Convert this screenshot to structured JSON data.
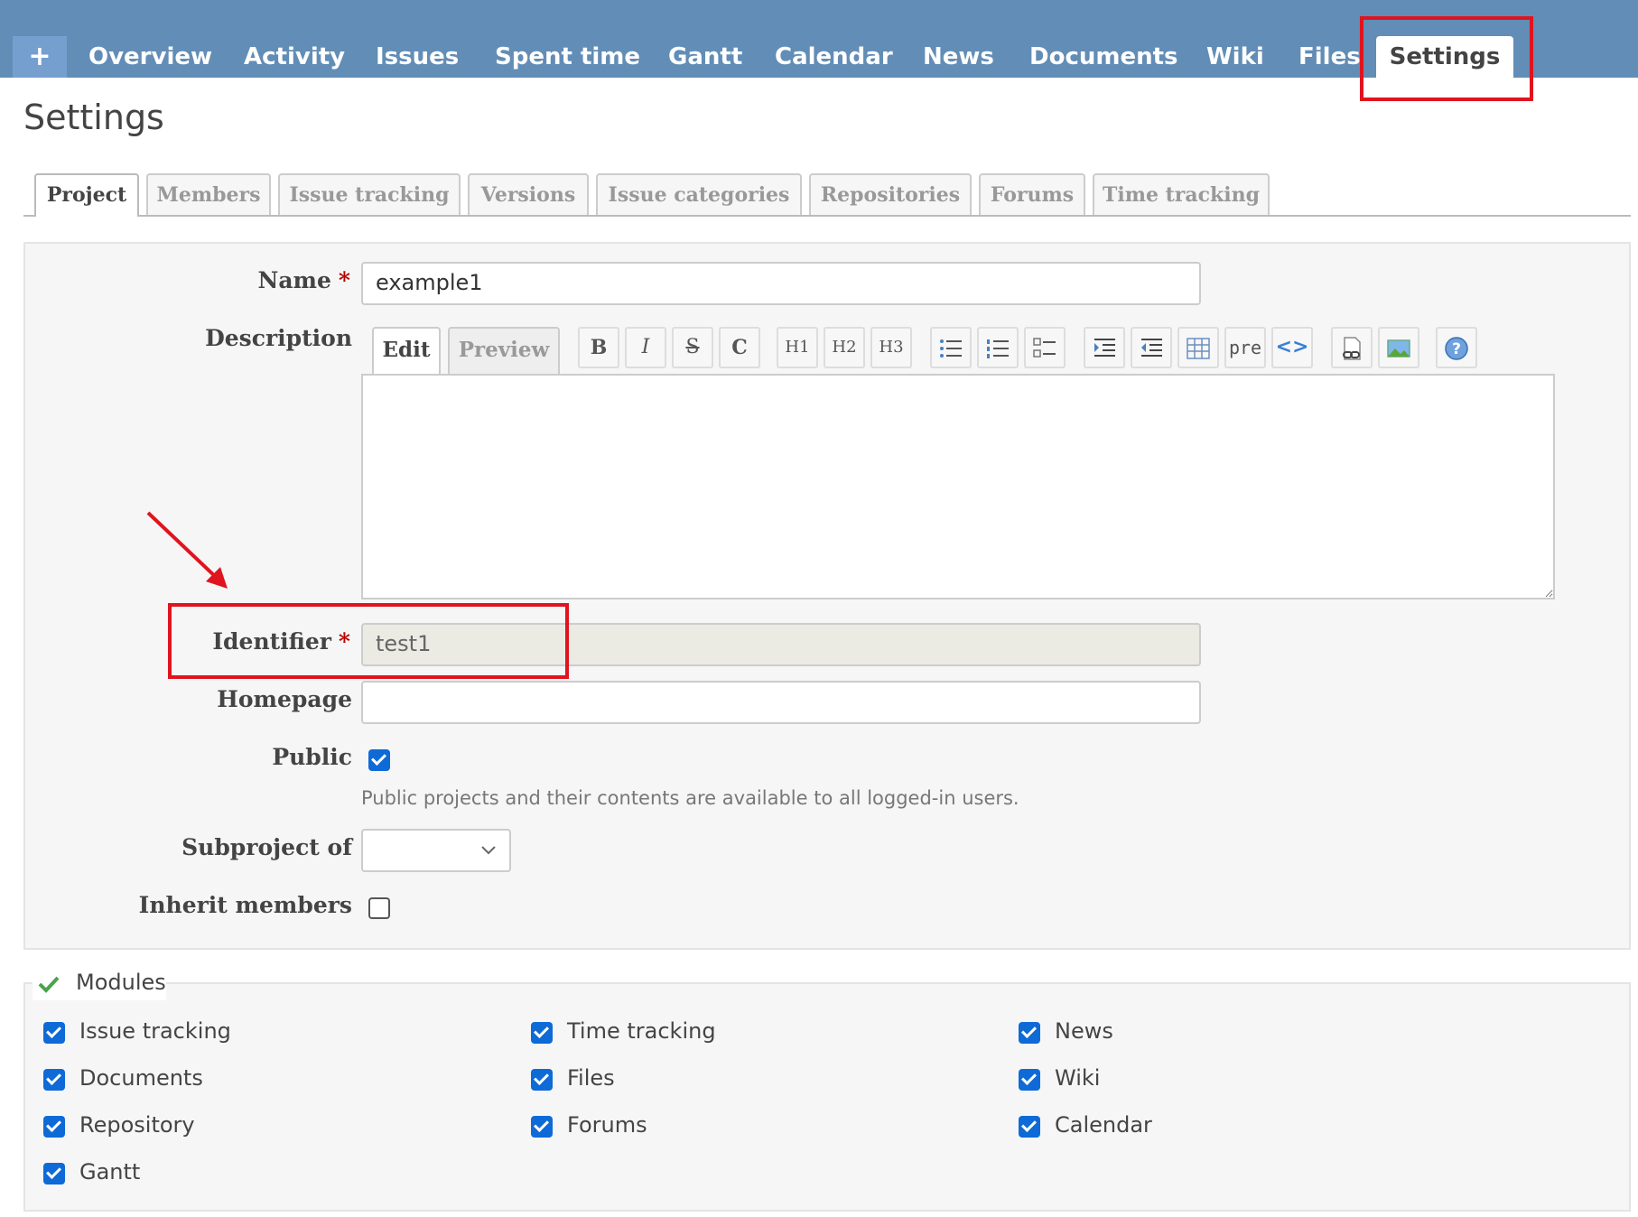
{
  "main_menu": {
    "new_label": "+",
    "items": [
      "Overview",
      "Activity",
      "Issues",
      "Spent time",
      "Gantt",
      "Calendar",
      "News",
      "Documents",
      "Wiki",
      "Files"
    ],
    "selected": "Settings"
  },
  "page_title": "Settings",
  "tabs": [
    {
      "label": "Project",
      "active": true
    },
    {
      "label": "Members",
      "active": false
    },
    {
      "label": "Issue tracking",
      "active": false
    },
    {
      "label": "Versions",
      "active": false
    },
    {
      "label": "Issue categories",
      "active": false
    },
    {
      "label": "Repositories",
      "active": false
    },
    {
      "label": "Forums",
      "active": false
    },
    {
      "label": "Time tracking",
      "active": false
    }
  ],
  "form": {
    "required_mark": "*",
    "name": {
      "label": "Name",
      "value": "example1"
    },
    "description": {
      "label": "Description",
      "edit_tab": "Edit",
      "preview_tab": "Preview",
      "toolbar": {
        "bold": "B",
        "italic": "I",
        "strike": "S",
        "code": "C",
        "h1": "H1",
        "h2": "H2",
        "h3": "H3",
        "pre": "pre",
        "inline_code": "<>"
      },
      "value": ""
    },
    "identifier": {
      "label": "Identifier",
      "value": "test1",
      "disabled": true
    },
    "homepage": {
      "label": "Homepage",
      "value": ""
    },
    "public": {
      "label": "Public",
      "checked": true,
      "hint": "Public projects and their contents are available to all logged-in users."
    },
    "subproject_of": {
      "label": "Subproject of",
      "value": ""
    },
    "inherit_members": {
      "label": "Inherit members",
      "checked": false
    }
  },
  "modules": {
    "legend": "Modules",
    "items": [
      {
        "label": "Issue tracking",
        "checked": true
      },
      {
        "label": "Time tracking",
        "checked": true
      },
      {
        "label": "News",
        "checked": true
      },
      {
        "label": "Documents",
        "checked": true
      },
      {
        "label": "Files",
        "checked": true
      },
      {
        "label": "Wiki",
        "checked": true
      },
      {
        "label": "Repository",
        "checked": true
      },
      {
        "label": "Forums",
        "checked": true
      },
      {
        "label": "Calendar",
        "checked": true
      },
      {
        "label": "Gantt",
        "checked": true
      }
    ]
  },
  "colors": {
    "menu_bg": "#628db6",
    "highlight": "#e0141e",
    "checkbox": "#0e6ad7"
  }
}
